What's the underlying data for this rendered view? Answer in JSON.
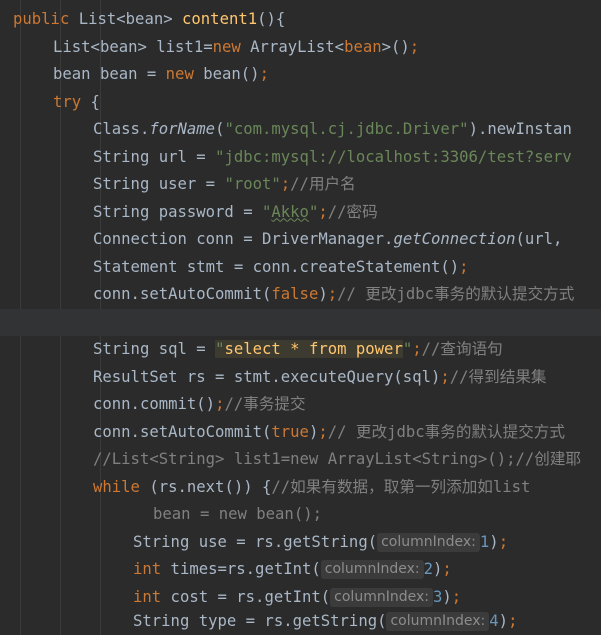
{
  "editor": {
    "line1": {
      "kw_public": "public",
      "t_list": " List<bean> ",
      "fn_name": "content1",
      "punct": "(){"
    },
    "line2": {
      "t1": "List<bean> list1=",
      "kw_new": "new",
      "t2": " ArrayList<",
      "generic": "bean",
      "t3": ">()",
      "semi": ";"
    },
    "line3": {
      "t1": "bean bean = ",
      "kw_new": "new",
      "t2": " bean()",
      "semi": ";"
    },
    "line4": {
      "kw_try": "try",
      "t1": " {"
    },
    "line5": {
      "t1": "Class.",
      "method": "forName",
      "t2": "(",
      "str": "\"com.mysql.cj.jdbc.Driver\"",
      "t3": ").newInstan"
    },
    "line6": {
      "t1": "String url = ",
      "str": "\"jdbc:mysql://localhost:3306/test?serv"
    },
    "line7": {
      "t1": "String user = ",
      "str": "\"root\"",
      "semi": ";",
      "comment": "//用户名"
    },
    "line8": {
      "t1": "String password = ",
      "q1": "\"",
      "typo": "Akko",
      "q2": "\"",
      "semi": ";",
      "comment": "//密码"
    },
    "line9": {
      "t1": "Connection conn = DriverManager.",
      "method": "getConnection",
      "t2": "(url,"
    },
    "line10": {
      "t1": "Statement stmt = conn.createStatement()",
      "semi": ";"
    },
    "line11": {
      "t1": "conn.setAutoCommit(",
      "kw_false": "false",
      "t2": ")",
      "semi": ";",
      "comment": "// 更改jdbc事务的默认提交方式"
    },
    "line13": {
      "t1": "String sql = ",
      "q1": "\"",
      "hl": "select * from power",
      "q2": "\"",
      "semi": ";",
      "comment": "//查询语句"
    },
    "line14": {
      "t1": "ResultSet rs = stmt.executeQuery(sql)",
      "semi": ";",
      "comment": "//得到结果集"
    },
    "line15": {
      "t1": "conn.commit()",
      "semi": ";",
      "comment": "//事务提交"
    },
    "line16": {
      "t1": "conn.setAutoCommit(",
      "kw_true": "true",
      "t2": ")",
      "semi": ";",
      "comment": "// 更改jdbc事务的默认提交方式"
    },
    "line17": {
      "comment": "//List<String> list1=new ArrayList<String>();//创建耶"
    },
    "line18": {
      "kw_while": "while",
      "t1": " (rs.next()) {",
      "comment": "//如果有数据，取第一列添加如list"
    },
    "line19": {
      "text": "bean = new bean();"
    },
    "line20": {
      "t1": "String use = rs.getString(",
      "hint": "columnIndex:",
      "num": "1",
      "t2": ")",
      "semi": ";"
    },
    "line21": {
      "kw_int": "int",
      "t1": " times=rs.getInt(",
      "hint": "columnIndex:",
      "num": "2",
      "t2": ")",
      "semi": ";"
    },
    "line22": {
      "kw_int": "int",
      "t1": " cost = rs.getInt(",
      "hint": "columnIndex:",
      "num": "3",
      "t2": ")",
      "semi": ";"
    },
    "line23": {
      "t1": "String type = rs.getString(",
      "hint": "columnIndex:",
      "num": "4",
      "t2": ")",
      "semi": ";"
    }
  },
  "colors": {
    "background": "#2b2b2b",
    "keyword": "#cc7832",
    "function_decl": "#ffc66d",
    "string": "#6a8759",
    "comment": "#808080",
    "number": "#6897bb",
    "default_text": "#a9b7c6"
  }
}
